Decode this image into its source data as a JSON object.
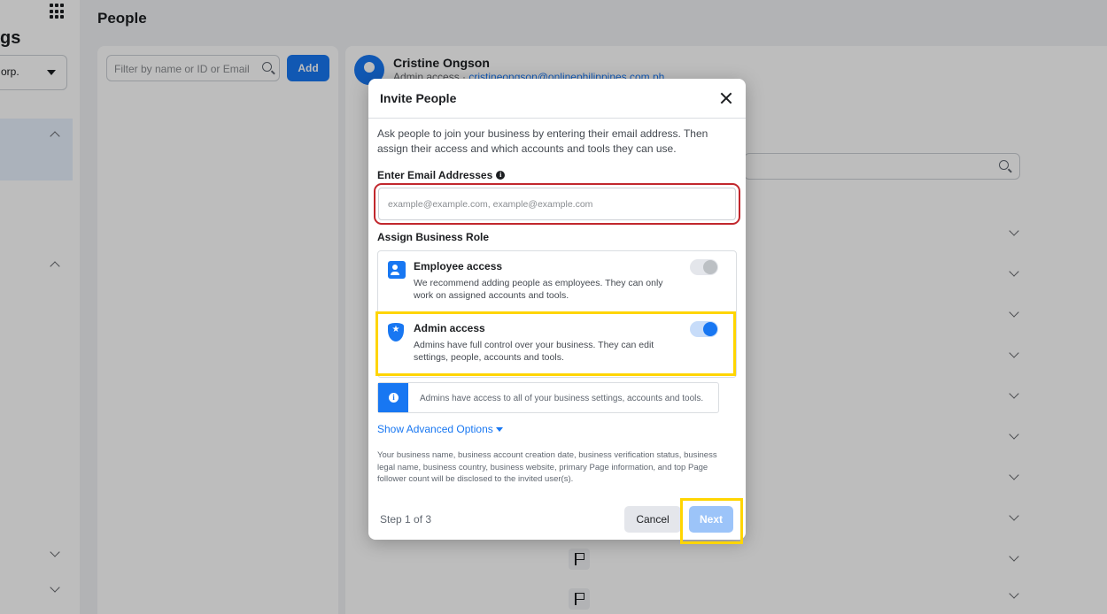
{
  "nav": {
    "title_partial": "gs",
    "corp_partial": "orp."
  },
  "page": {
    "title": "People"
  },
  "people_list": {
    "filter_placeholder": "Filter by name or ID or Email",
    "add_label": "Add"
  },
  "person": {
    "name": "Cristine Ongson",
    "access": "Admin access",
    "email": "cristineongson@onlinephilippines.com.ph"
  },
  "modal": {
    "title": "Invite People",
    "intro": "Ask people to join your business by entering their email address. Then assign their access and which accounts and tools they can use.",
    "email_label": "Enter Email Addresses",
    "email_placeholder": "example@example.com, example@example.com",
    "email_value": "",
    "role_label": "Assign Business Role",
    "roles": [
      {
        "name": "Employee access",
        "description": "We recommend adding people as employees. They can only work on assigned accounts and tools.",
        "icon": "employee-badge-icon",
        "enabled": false
      },
      {
        "name": "Admin access",
        "description": "Admins have full control over your business. They can edit settings, people, accounts and tools.",
        "icon": "shield-star-icon",
        "enabled": true
      }
    ],
    "notice": "Admins have access to all of your business settings, accounts and tools.",
    "advanced_label": "Show Advanced Options",
    "disclosure": "Your business name, business account creation date, business verification status, business legal name, business country, business website, primary Page information, and top Page follower count will be disclosed to the invited user(s).",
    "step": "Step 1 of 3",
    "cancel_label": "Cancel",
    "next_label": "Next"
  },
  "colors": {
    "accent": "#1877f2",
    "highlight_yellow": "#ffd500",
    "highlight_red": "#c1272d",
    "overlay": "rgba(0,0,0,0.26)"
  }
}
